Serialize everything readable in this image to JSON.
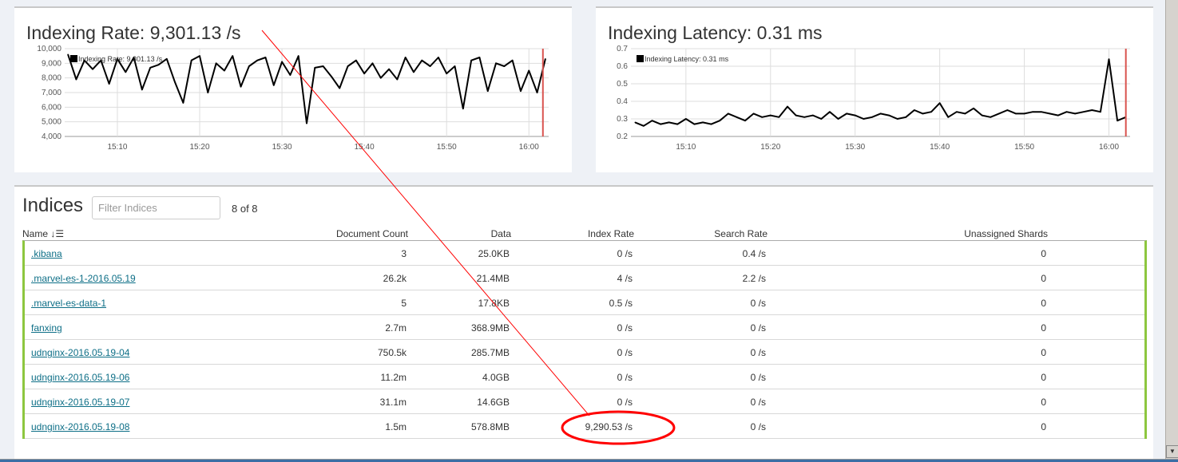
{
  "charts": [
    {
      "title": "Indexing Rate: 9,301.13 /s"
    },
    {
      "title": "Indexing Latency: 0.31 ms"
    }
  ],
  "chart_data": [
    {
      "type": "line",
      "title": "Indexing Rate: 9,301.13 /s",
      "legend": "Indexing Rate: 9,301.13 /s",
      "legend_placement": "top-left",
      "ylim": [
        4000,
        10000
      ],
      "yticks": [
        "4,000",
        "5,000",
        "6,000",
        "7,000",
        "8,000",
        "9,000",
        "10,000"
      ],
      "xticks": [
        "15:10",
        "15:20",
        "15:30",
        "15:40",
        "15:50",
        "16:00"
      ],
      "xlim": [
        "15:03:36",
        "16:02:24"
      ],
      "marker_time": "16:01:42",
      "grid": true,
      "series": [
        {
          "x": [
            "15:04",
            "15:05",
            "15:06",
            "15:07",
            "15:08",
            "15:09",
            "15:10",
            "15:11",
            "15:12",
            "15:13",
            "15:14",
            "15:15",
            "15:16",
            "15:17",
            "15:18",
            "15:19",
            "15:20",
            "15:21",
            "15:22",
            "15:23",
            "15:24",
            "15:25",
            "15:26",
            "15:27",
            "15:28",
            "15:29",
            "15:30",
            "15:31",
            "15:32",
            "15:33",
            "15:34",
            "15:35",
            "15:36",
            "15:37",
            "15:38",
            "15:39",
            "15:40",
            "15:41",
            "15:42",
            "15:43",
            "15:44",
            "15:45",
            "15:46",
            "15:47",
            "15:48",
            "15:49",
            "15:50",
            "15:51",
            "15:52",
            "15:53",
            "15:54",
            "15:55",
            "15:56",
            "15:57",
            "15:58",
            "15:59",
            "16:00",
            "16:01",
            "16:02"
          ],
          "values": [
            9600,
            7900,
            9200,
            8600,
            9200,
            7600,
            9300,
            8400,
            9400,
            7200,
            8700,
            8900,
            9300,
            7700,
            6300,
            9200,
            9500,
            7000,
            9000,
            8500,
            9500,
            7400,
            8800,
            9200,
            9400,
            7500,
            9100,
            8200,
            9500,
            4900,
            8700,
            8800,
            8100,
            7300,
            8800,
            9200,
            8300,
            9000,
            8000,
            8600,
            7900,
            9400,
            8400,
            9200,
            8800,
            9400,
            8300,
            8800,
            5900,
            9200,
            9400,
            7100,
            9000,
            8800,
            9200,
            7100,
            8500,
            7000,
            9300
          ]
        }
      ]
    },
    {
      "type": "line",
      "title": "Indexing Latency: 0.31 ms",
      "legend": "Indexing Latency: 0.31 ms",
      "legend_placement": "top-left",
      "ylim": [
        0.2,
        0.7
      ],
      "yticks": [
        "0.2",
        "0.3",
        "0.4",
        "0.5",
        "0.6",
        "0.7"
      ],
      "xticks": [
        "15:10",
        "15:20",
        "15:30",
        "15:40",
        "15:50",
        "16:00"
      ],
      "xlim": [
        "15:03:30",
        "16:02:30"
      ],
      "marker_time": "16:02:00",
      "grid": true,
      "series": [
        {
          "x": [
            "15:04",
            "15:05",
            "15:06",
            "15:07",
            "15:08",
            "15:09",
            "15:10",
            "15:11",
            "15:12",
            "15:13",
            "15:14",
            "15:15",
            "15:16",
            "15:17",
            "15:18",
            "15:19",
            "15:20",
            "15:21",
            "15:22",
            "15:23",
            "15:24",
            "15:25",
            "15:26",
            "15:27",
            "15:28",
            "15:29",
            "15:30",
            "15:31",
            "15:32",
            "15:33",
            "15:34",
            "15:35",
            "15:36",
            "15:37",
            "15:38",
            "15:39",
            "15:40",
            "15:41",
            "15:42",
            "15:43",
            "15:44",
            "15:45",
            "15:46",
            "15:47",
            "15:48",
            "15:49",
            "15:50",
            "15:51",
            "15:52",
            "15:53",
            "15:54",
            "15:55",
            "15:56",
            "15:57",
            "15:58",
            "15:59",
            "16:00",
            "16:01",
            "16:02"
          ],
          "values": [
            0.28,
            0.26,
            0.29,
            0.27,
            0.28,
            0.27,
            0.3,
            0.27,
            0.28,
            0.27,
            0.29,
            0.33,
            0.31,
            0.29,
            0.33,
            0.31,
            0.32,
            0.31,
            0.37,
            0.32,
            0.31,
            0.32,
            0.3,
            0.34,
            0.3,
            0.33,
            0.32,
            0.3,
            0.31,
            0.33,
            0.32,
            0.3,
            0.31,
            0.35,
            0.33,
            0.34,
            0.39,
            0.31,
            0.34,
            0.33,
            0.36,
            0.32,
            0.31,
            0.33,
            0.35,
            0.33,
            0.33,
            0.34,
            0.34,
            0.33,
            0.32,
            0.34,
            0.33,
            0.34,
            0.35,
            0.34,
            0.64,
            0.29,
            0.31
          ]
        }
      ]
    }
  ],
  "indices": {
    "title": "Indices",
    "filter_placeholder": "Filter Indices",
    "filter_value": "",
    "count": "8 of 8",
    "columns": [
      "Name",
      "Document Count",
      "Data",
      "Index Rate",
      "Search Rate",
      "Unassigned Shards"
    ],
    "rows": [
      {
        "name": ".kibana",
        "docs": "3",
        "data": "25.0KB",
        "index_rate": "0 /s",
        "search_rate": "0.4 /s",
        "unassigned": "0"
      },
      {
        "name": ".marvel-es-1-2016.05.19",
        "docs": "26.2k",
        "data": "21.4MB",
        "index_rate": "4 /s",
        "search_rate": "2.2 /s",
        "unassigned": "0"
      },
      {
        "name": ".marvel-es-data-1",
        "docs": "5",
        "data": "17.8KB",
        "index_rate": "0.5 /s",
        "search_rate": "0 /s",
        "unassigned": "0"
      },
      {
        "name": "fanxing",
        "docs": "2.7m",
        "data": "368.9MB",
        "index_rate": "0 /s",
        "search_rate": "0 /s",
        "unassigned": "0"
      },
      {
        "name": "udnginx-2016.05.19-04",
        "docs": "750.5k",
        "data": "285.7MB",
        "index_rate": "0 /s",
        "search_rate": "0 /s",
        "unassigned": "0"
      },
      {
        "name": "udnginx-2016.05.19-06",
        "docs": "11.2m",
        "data": "4.0GB",
        "index_rate": "0 /s",
        "search_rate": "0 /s",
        "unassigned": "0"
      },
      {
        "name": "udnginx-2016.05.19-07",
        "docs": "31.1m",
        "data": "14.6GB",
        "index_rate": "0 /s",
        "search_rate": "0 /s",
        "unassigned": "0"
      },
      {
        "name": "udnginx-2016.05.19-08",
        "docs": "1.5m",
        "data": "578.8MB",
        "index_rate": "9,290.53 /s",
        "search_rate": "0 /s",
        "unassigned": "0"
      }
    ]
  },
  "colors": {
    "accent_border": "#8dc63f",
    "link": "#0e6f87",
    "annotation": "#ff0000",
    "marker": "#d9534f"
  }
}
